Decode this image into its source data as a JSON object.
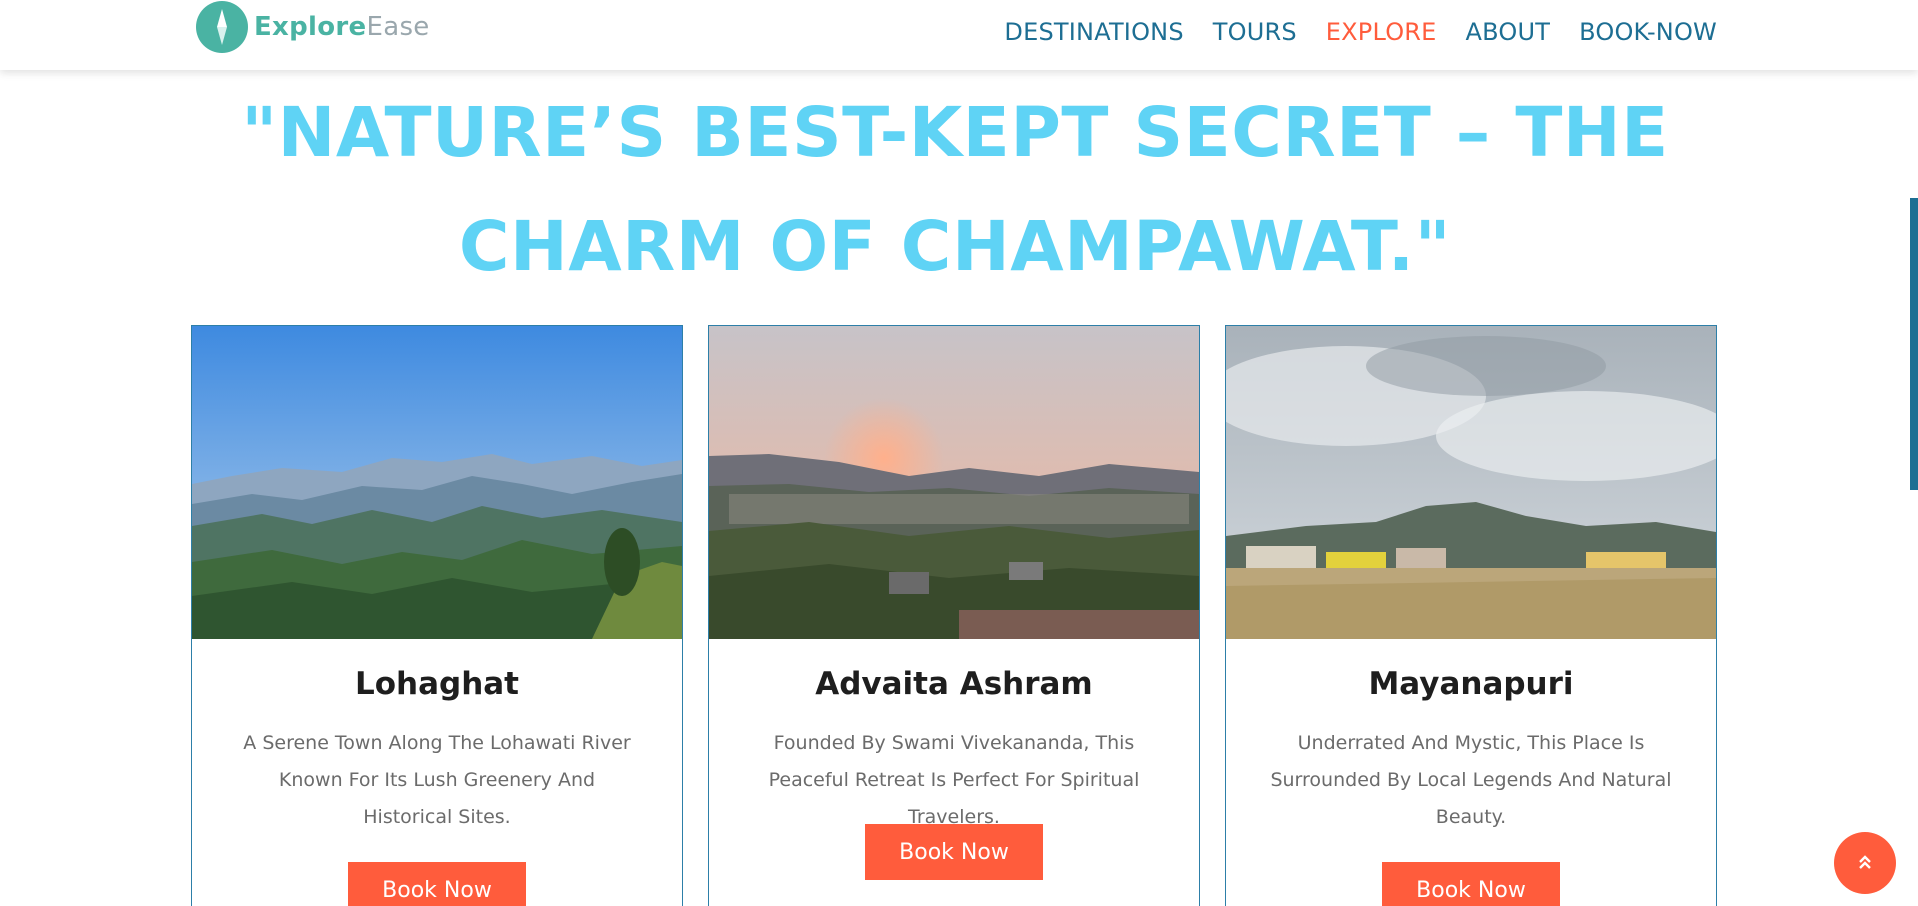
{
  "header": {
    "logo": {
      "part1": "Explore",
      "part2": "Ease",
      "icon": "compass-icon"
    },
    "nav": [
      {
        "label": "DESTINATIONS",
        "active": false
      },
      {
        "label": "TOURS",
        "active": false
      },
      {
        "label": "EXPLORE",
        "active": true
      },
      {
        "label": "ABOUT",
        "active": false
      },
      {
        "label": "BOOK-NOW",
        "active": false
      }
    ]
  },
  "hero": {
    "quote_line1": "\"NATURE’S BEST-KEPT SECRET – THE",
    "quote_line2": "CHARM OF CHAMPAWAT.\""
  },
  "cards": [
    {
      "title": "Lohaghat",
      "description": "A Serene Town Along The Lohawati River Known For Its Lush Greenery And Historical Sites.",
      "button_label": "Book Now"
    },
    {
      "title": "Advaita Ashram",
      "description": "Founded By Swami Vivekananda, This Peaceful Retreat Is Perfect For Spiritual Travelers.",
      "button_label": "Book Now"
    },
    {
      "title": "Mayanapuri",
      "description": "Underrated And Mystic, This Place Is Surrounded By Local Legends And Natural Beauty.",
      "button_label": "Book Now"
    }
  ],
  "back_to_top": {
    "icon": "double-chevron-up-icon"
  },
  "colors": {
    "accent": "#ff5c3c",
    "nav_text": "#1d6e93",
    "quote": "#5fd3f5",
    "logo_teal": "#4ab3a3"
  }
}
